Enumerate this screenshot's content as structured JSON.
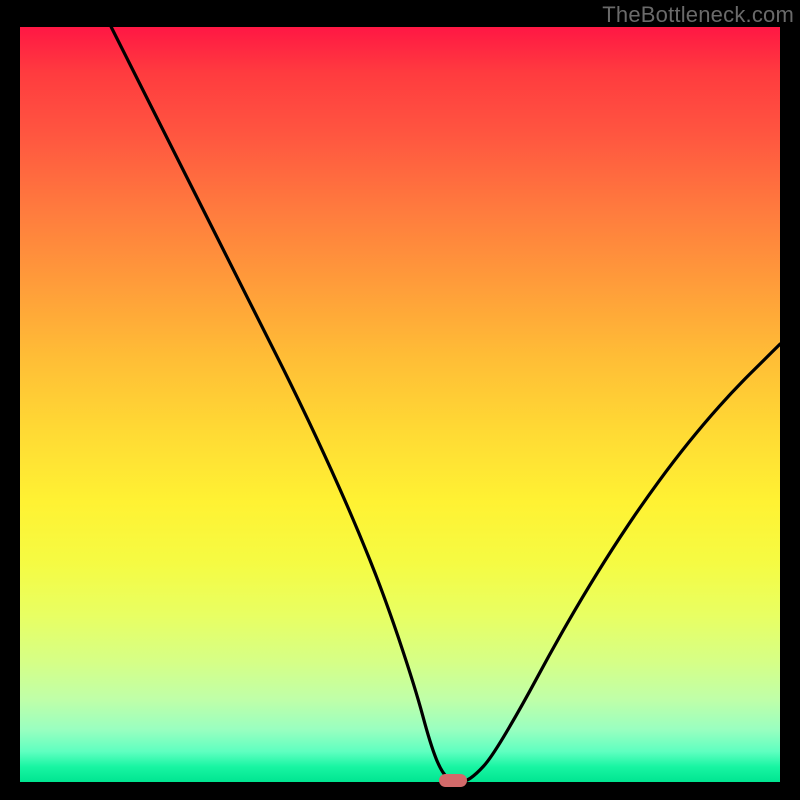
{
  "watermark": "TheBottleneck.com",
  "chart_data": {
    "type": "line",
    "title": "",
    "xlabel": "",
    "ylabel": "",
    "xlim": [
      0,
      100
    ],
    "ylim": [
      0,
      100
    ],
    "grid": false,
    "legend": false,
    "marker": {
      "x": 57,
      "y": 0,
      "color": "#d26a6a"
    },
    "series": [
      {
        "name": "curve",
        "color": "#000000",
        "x": [
          12,
          16,
          20,
          24,
          28,
          32,
          36,
          40,
          44,
          48,
          52,
          54,
          55.5,
          57,
          58.5,
          60,
          62,
          66,
          70,
          74,
          78,
          82,
          86,
          90,
          94,
          98,
          100
        ],
        "y": [
          100,
          92,
          84,
          76,
          68,
          60,
          52,
          43.5,
          34.5,
          24.5,
          12.5,
          5,
          1.2,
          0,
          0,
          1,
          3.2,
          10,
          17.5,
          24.5,
          31,
          37,
          42.5,
          47.5,
          52,
          56,
          58
        ]
      }
    ]
  }
}
